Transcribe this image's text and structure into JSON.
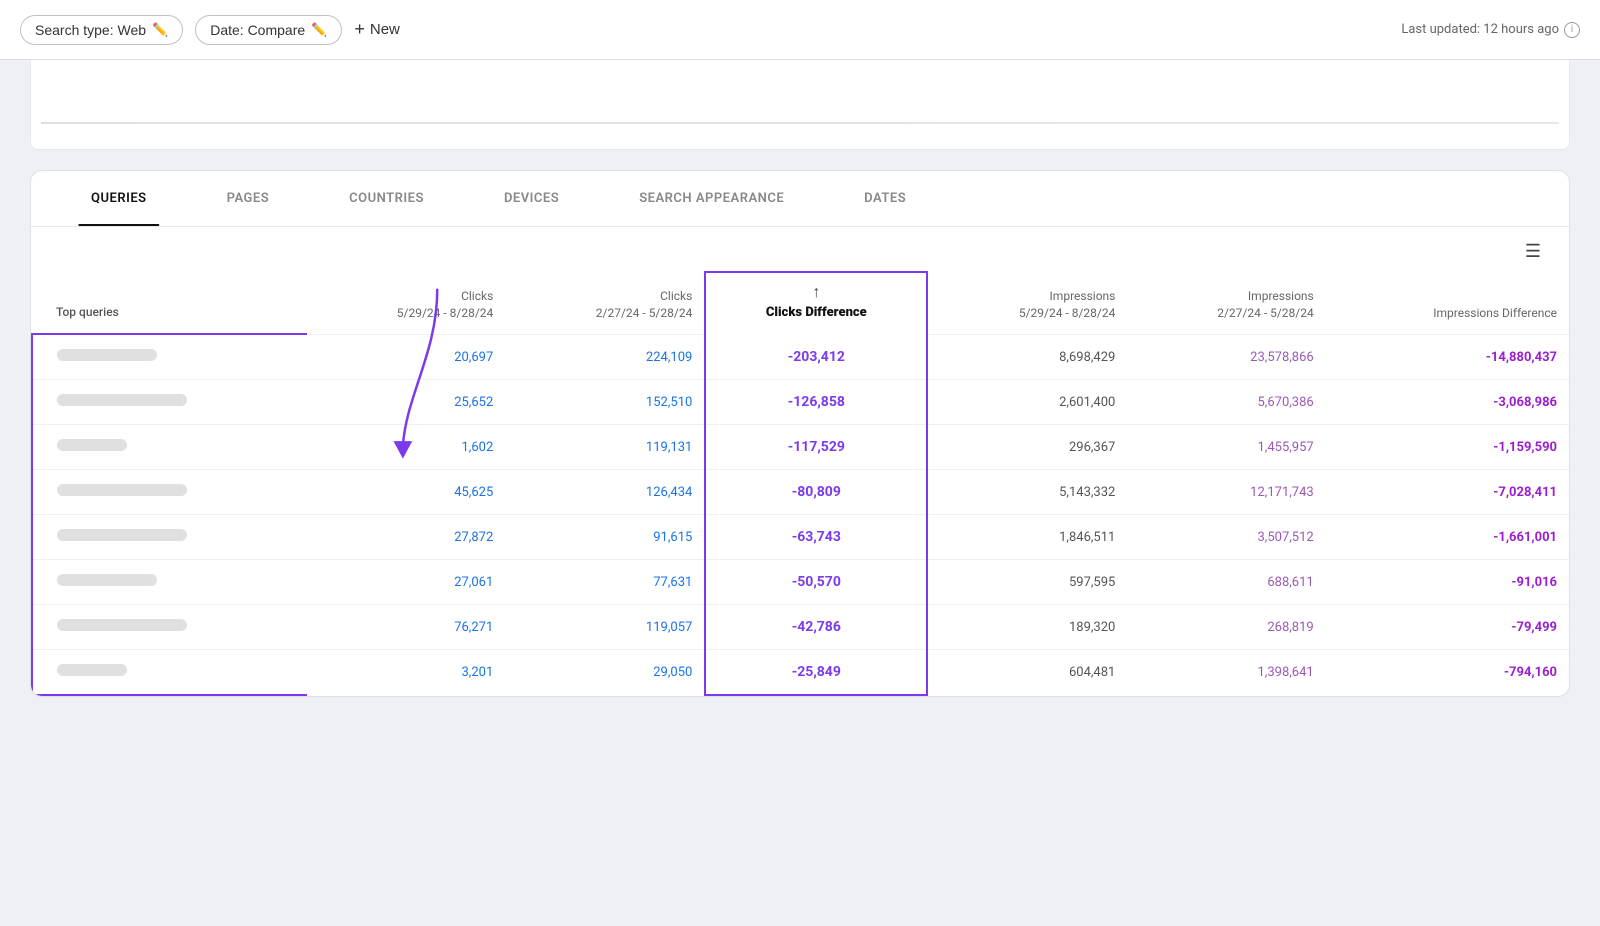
{
  "topbar": {
    "filter1_label": "Search type: Web",
    "filter2_label": "Date: Compare",
    "new_label": "New",
    "last_updated": "Last updated: 12 hours ago"
  },
  "tabs": {
    "items": [
      {
        "id": "queries",
        "label": "QUERIES",
        "active": true
      },
      {
        "id": "pages",
        "label": "PAGES",
        "active": false
      },
      {
        "id": "countries",
        "label": "COUNTRIES",
        "active": false
      },
      {
        "id": "devices",
        "label": "DEVICES",
        "active": false
      },
      {
        "id": "search_appearance",
        "label": "SEARCH APPEARANCE",
        "active": false
      },
      {
        "id": "dates",
        "label": "DATES",
        "active": false
      }
    ]
  },
  "table": {
    "col_query": "Top queries",
    "col_clicks_new_label": "Clicks",
    "col_clicks_new_range": "5/29/24 - 8/28/24",
    "col_clicks_old_label": "Clicks",
    "col_clicks_old_range": "2/27/24 - 5/28/24",
    "col_diff_label": "Clicks Difference",
    "col_impressions_new_label": "Impressions",
    "col_impressions_new_range": "5/29/24 - 8/28/24",
    "col_impressions_old_label": "Impressions",
    "col_impressions_old_range": "2/27/24 - 5/28/24",
    "col_impressions_diff_label": "Impressions Difference",
    "rows": [
      {
        "id": 1,
        "query_width": "medium",
        "clicks_new": "20,697",
        "clicks_old": "224,109",
        "clicks_diff": "-203,412",
        "impressions_new": "8,698,429",
        "impressions_old": "23,578,866",
        "impressions_diff": "-14,880,437"
      },
      {
        "id": 2,
        "query_width": "long",
        "clicks_new": "25,652",
        "clicks_old": "152,510",
        "clicks_diff": "-126,858",
        "impressions_new": "2,601,400",
        "impressions_old": "5,670,386",
        "impressions_diff": "-3,068,986"
      },
      {
        "id": 3,
        "query_width": "short",
        "clicks_new": "1,602",
        "clicks_old": "119,131",
        "clicks_diff": "-117,529",
        "impressions_new": "296,367",
        "impressions_old": "1,455,957",
        "impressions_diff": "-1,159,590"
      },
      {
        "id": 4,
        "query_width": "long",
        "clicks_new": "45,625",
        "clicks_old": "126,434",
        "clicks_diff": "-80,809",
        "impressions_new": "5,143,332",
        "impressions_old": "12,171,743",
        "impressions_diff": "-7,028,411"
      },
      {
        "id": 5,
        "query_width": "long",
        "clicks_new": "27,872",
        "clicks_old": "91,615",
        "clicks_diff": "-63,743",
        "impressions_new": "1,846,511",
        "impressions_old": "3,507,512",
        "impressions_diff": "-1,661,001"
      },
      {
        "id": 6,
        "query_width": "medium",
        "clicks_new": "27,061",
        "clicks_old": "77,631",
        "clicks_diff": "-50,570",
        "impressions_new": "597,595",
        "impressions_old": "688,611",
        "impressions_diff": "-91,016"
      },
      {
        "id": 7,
        "query_width": "long",
        "clicks_new": "76,271",
        "clicks_old": "119,057",
        "clicks_diff": "-42,786",
        "impressions_new": "189,320",
        "impressions_old": "268,819",
        "impressions_diff": "-79,499"
      },
      {
        "id": 8,
        "query_width": "short",
        "clicks_new": "3,201",
        "clicks_old": "29,050",
        "clicks_diff": "-25,849",
        "impressions_new": "604,481",
        "impressions_old": "1,398,641",
        "impressions_diff": "-794,160"
      }
    ]
  }
}
